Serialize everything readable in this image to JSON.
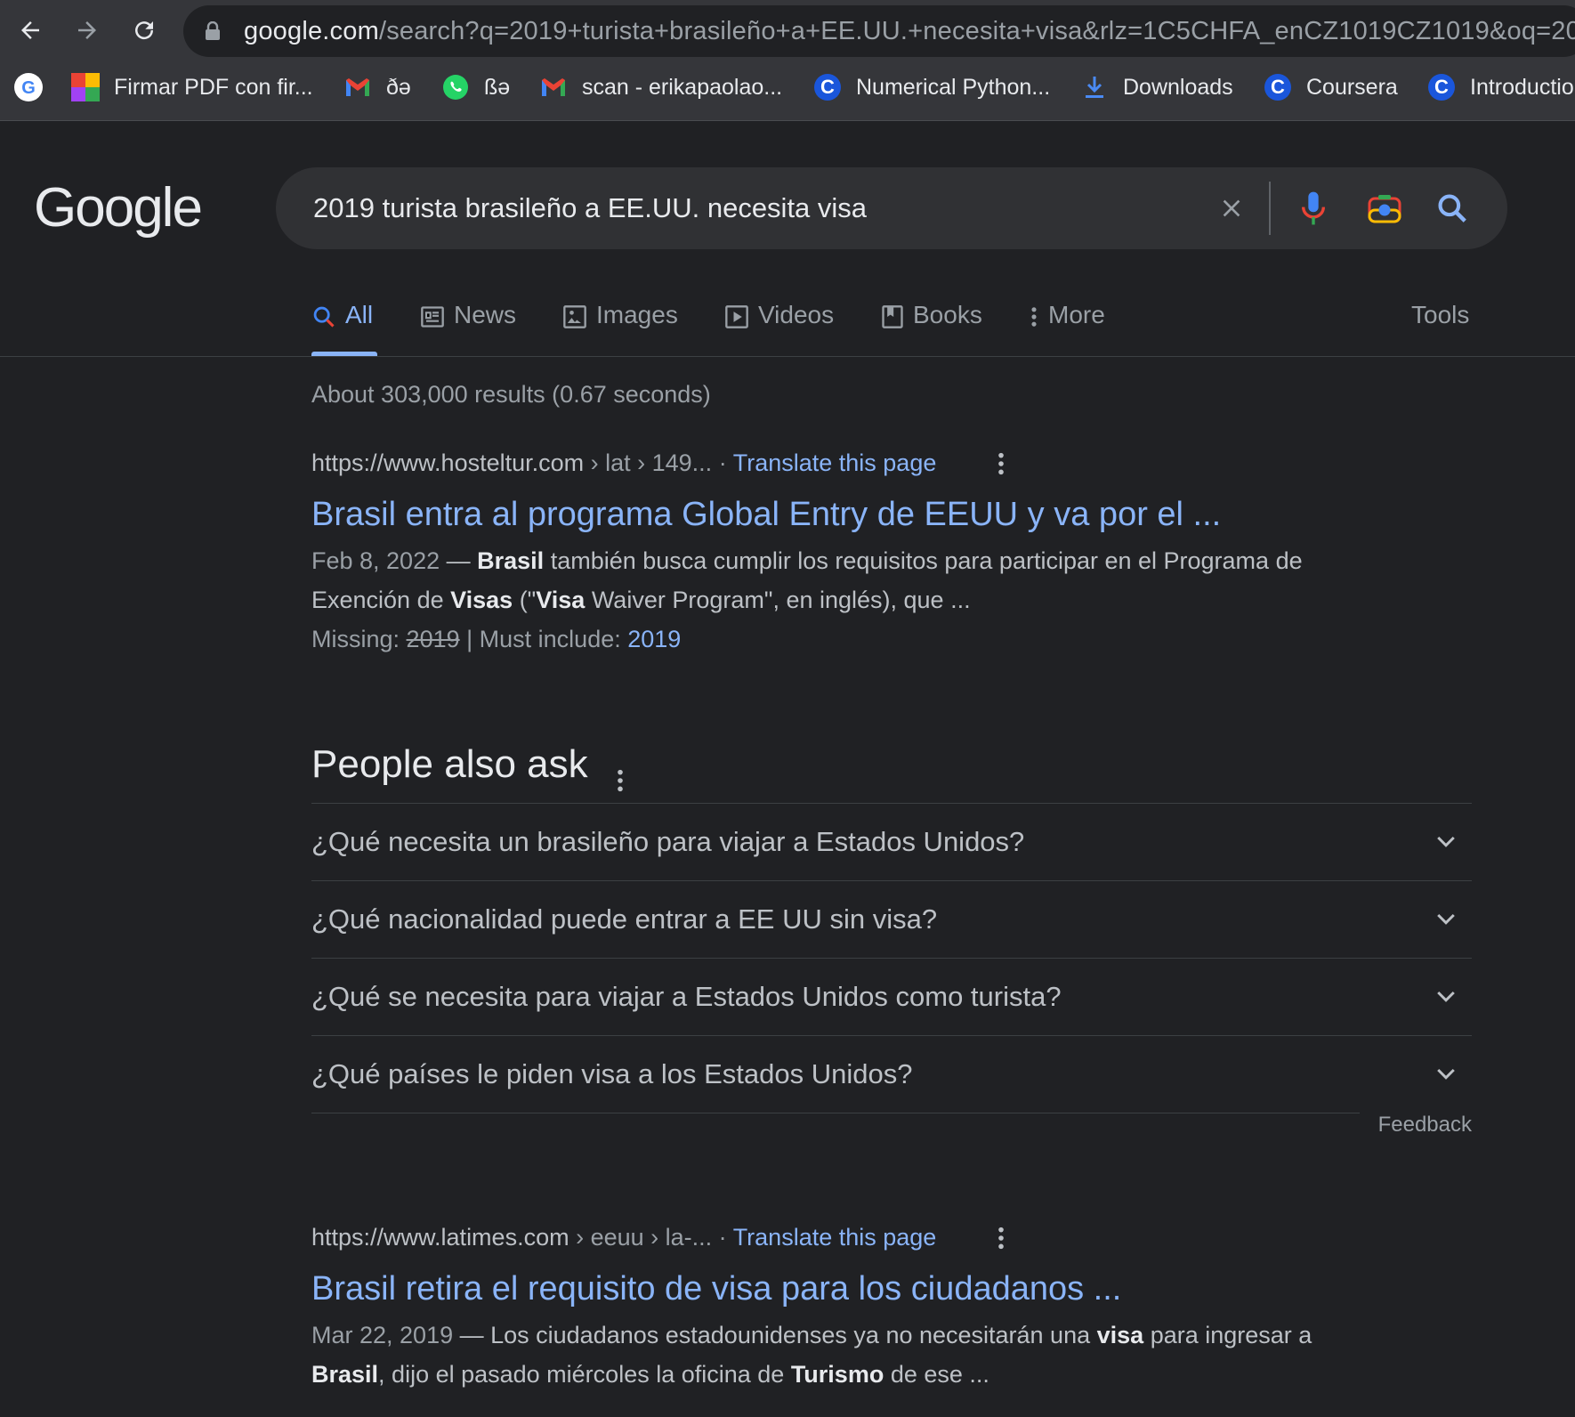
{
  "browser": {
    "url_host": "google.com",
    "url_rest": "/search?q=2019+turista+brasileño+a+EE.UU.+necesita+visa&rlz=1C5CHFA_enCZ1019CZ1019&oq=20",
    "bookmarks": [
      {
        "label": "",
        "icon": "google-g-icon"
      },
      {
        "label": "Firmar PDF con fir...",
        "icon": "colorful-grid-icon"
      },
      {
        "label": "ðə",
        "icon": "gmail-icon"
      },
      {
        "label": "ßə",
        "icon": "whatsapp-icon"
      },
      {
        "label": "scan - erikapaolao...",
        "icon": "gmail-icon"
      },
      {
        "label": "Numerical Python...",
        "icon": "coursera-c-icon"
      },
      {
        "label": "Downloads",
        "icon": "download-icon"
      },
      {
        "label": "Coursera",
        "icon": "coursera-c-icon"
      },
      {
        "label": "Introductio",
        "icon": "coursera-c-icon"
      }
    ]
  },
  "search": {
    "logo": "Google",
    "query": "2019 turista brasileño a EE.UU. necesita visa"
  },
  "tabs": [
    {
      "label": "All",
      "icon": "search-icon",
      "active": true
    },
    {
      "label": "News",
      "icon": "news-icon"
    },
    {
      "label": "Images",
      "icon": "image-icon"
    },
    {
      "label": "Videos",
      "icon": "video-icon"
    },
    {
      "label": "Books",
      "icon": "book-icon"
    },
    {
      "label": "More",
      "icon": "more-vert-icon"
    }
  ],
  "tools_label": "Tools",
  "stats": "About 303,000 results (0.67 seconds)",
  "results": [
    {
      "site": "https://www.hosteltur.com",
      "path": " › lat › 149...",
      "translate": "Translate this page",
      "title": "Brasil entra al programa Global Entry de EEUU y va por el ...",
      "date": "Feb 8, 2022",
      "missing_label": "Missing:",
      "missing_term": "2019",
      "must_label": "Must include:",
      "must_term": "2019"
    },
    {
      "site": "https://www.latimes.com",
      "path": " › eeuu › la-...",
      "translate": "Translate this page",
      "title": "Brasil retira el requisito de visa para los ciudadanos ...",
      "date": "Mar 22, 2019"
    }
  ],
  "paa": {
    "heading": "People also ask",
    "questions": [
      "¿Qué necesita un brasileño para viajar a Estados Unidos?",
      "¿Qué nacionalidad puede entrar a EE UU sin visa?",
      "¿Qué se necesita para viajar a Estados Unidos como turista?",
      "¿Qué países le piden visa a los Estados Unidos?"
    ],
    "feedback": "Feedback"
  },
  "colors": {
    "link": "#8ab4f8",
    "background": "#202124",
    "text": "#bdc1c6"
  }
}
